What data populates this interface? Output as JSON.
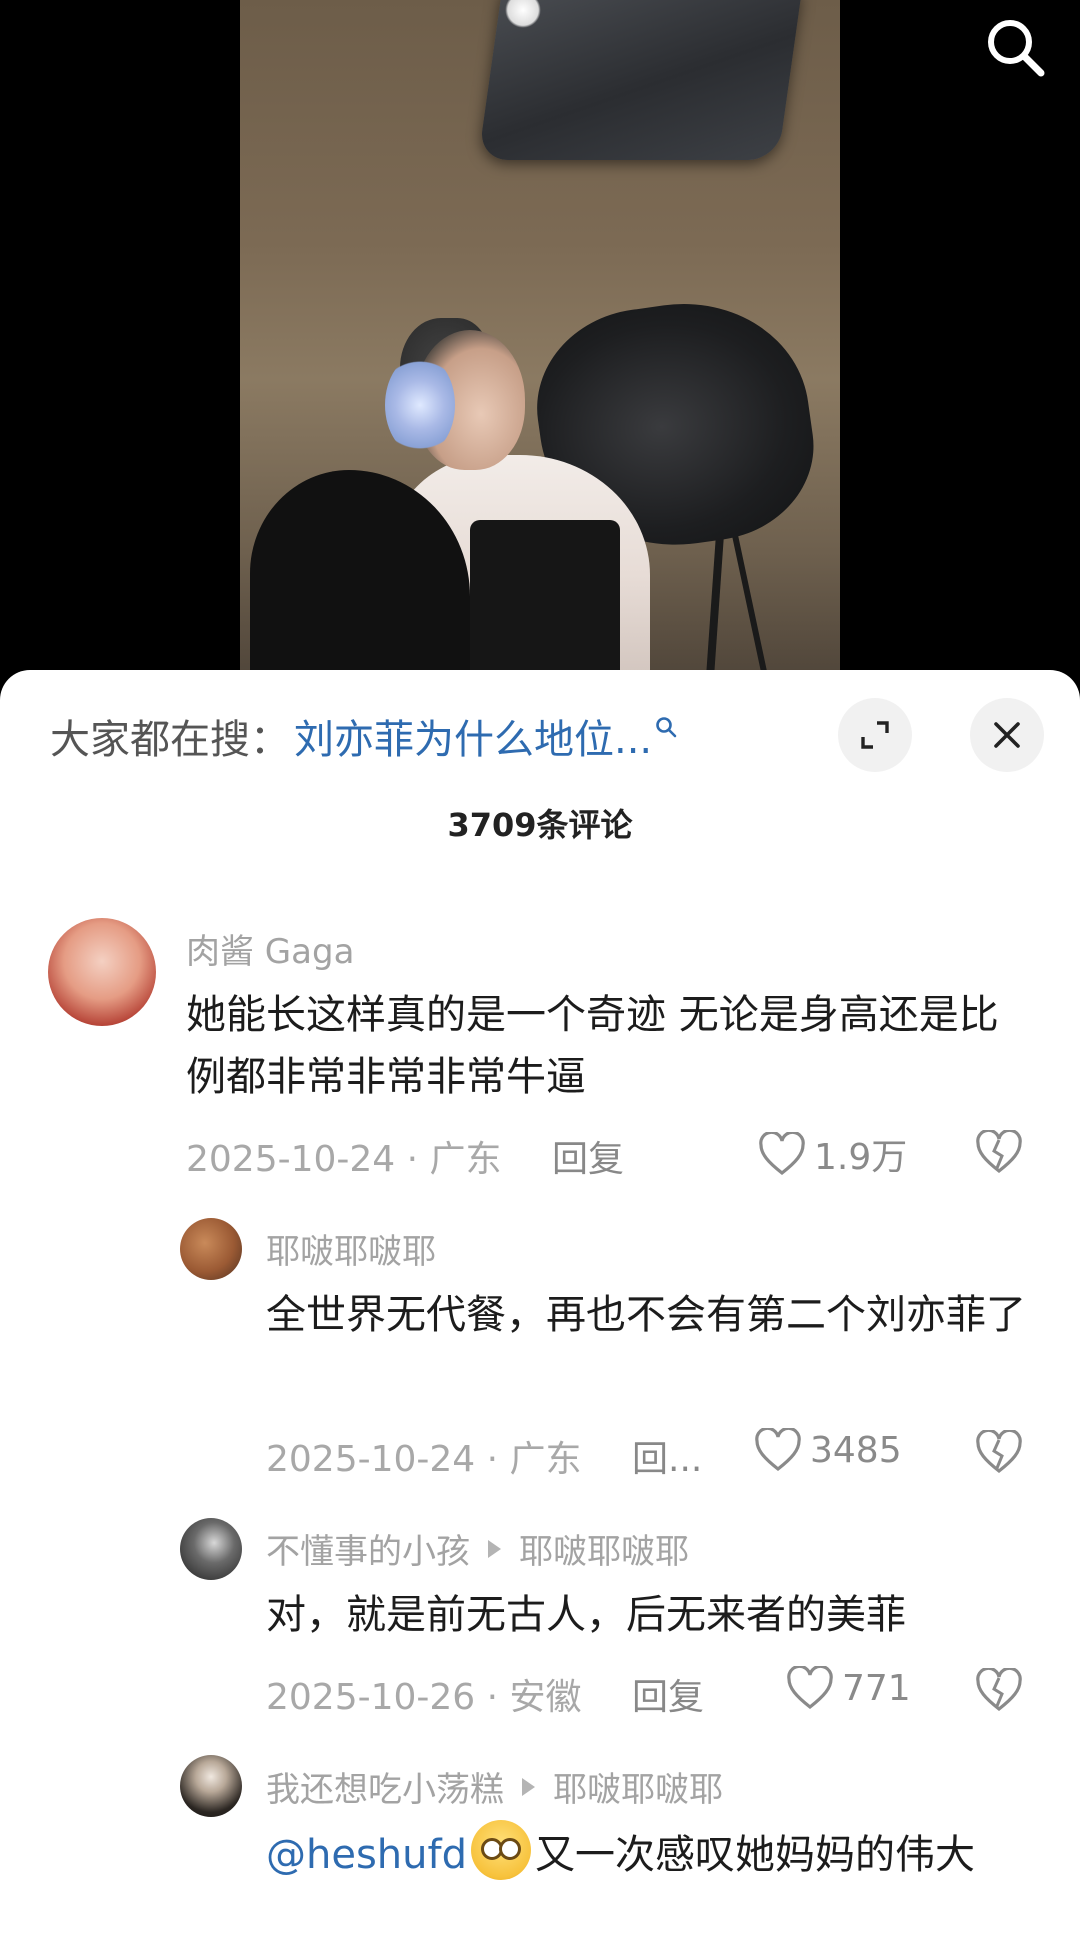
{
  "hot_search": {
    "label": "大家都在搜：",
    "keyword": "刘亦菲为什么地位..."
  },
  "comment_count": "3709条评论",
  "comments": [
    {
      "user": "肉酱 Gaga",
      "text": "她能长这样真的是一个奇迹 无论是身高还是比例都非常非常非常牛逼",
      "meta": "2025-10-24 · 广东",
      "reply": "回复",
      "likes": "1.9万"
    },
    {
      "user": "耶啵耶啵耶",
      "text": "全世界无代餐，再也不会有第二个刘亦菲了",
      "meta": "2025-10-24 · 广东",
      "reply": "回...",
      "likes": "3485"
    },
    {
      "user": "不懂事的小孩",
      "reply_to": "耶啵耶啵耶",
      "text": "对，就是前无古人，后无来者的美菲",
      "meta": "2025-10-26 · 安徽",
      "reply": "回复",
      "likes": "771"
    },
    {
      "user": "我还想吃小荡糕",
      "reply_to": "耶啵耶啵耶",
      "mention": "@heshufd",
      "text": "又一次感叹她妈妈的伟大",
      "emoji": "pleading-face"
    }
  ],
  "icons": {
    "search": "search-icon",
    "expand": "expand-icon",
    "close": "close-icon",
    "like": "heart-icon",
    "dislike": "broken-heart-icon"
  },
  "colors": {
    "link": "#2e6bb0",
    "secondary_text": "#a3a3a3",
    "sheet_bg": "#ffffff",
    "video_bg": "#000000"
  }
}
